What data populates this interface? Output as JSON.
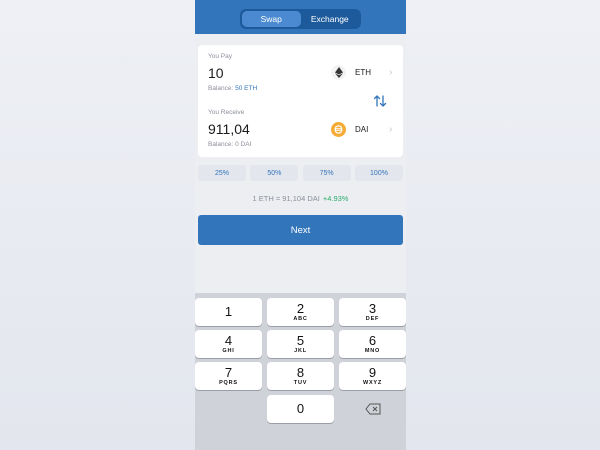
{
  "tabs": {
    "swap": "Swap",
    "exchange": "Exchange",
    "active": "swap"
  },
  "pay": {
    "label": "You Pay",
    "amount": "10",
    "token": "ETH",
    "token_icon": "ethereum-icon",
    "balance_label": "Balance:",
    "balance_value": "50 ETH"
  },
  "receive": {
    "label": "You Receive",
    "amount": "911,04",
    "token": "DAI",
    "token_icon": "dai-icon",
    "balance_label": "Balance:",
    "balance_value": "0 DAI"
  },
  "percentages": [
    "25%",
    "50%",
    "75%",
    "100%"
  ],
  "rate": {
    "text": "1 ETH = 91,104 DAI",
    "change": "+4.93%"
  },
  "next_label": "Next",
  "keypad": [
    {
      "digit": "1",
      "letters": ""
    },
    {
      "digit": "2",
      "letters": "ABC"
    },
    {
      "digit": "3",
      "letters": "DEF"
    },
    {
      "digit": "4",
      "letters": "GHI"
    },
    {
      "digit": "5",
      "letters": "JKL"
    },
    {
      "digit": "6",
      "letters": "MNO"
    },
    {
      "digit": "7",
      "letters": "PQRS"
    },
    {
      "digit": "8",
      "letters": "TUV"
    },
    {
      "digit": "9",
      "letters": "WXYZ"
    },
    {
      "digit": "0",
      "letters": ""
    }
  ],
  "colors": {
    "primary": "#3375bb",
    "positive": "#2dae6b",
    "dai": "#f5ac37"
  }
}
